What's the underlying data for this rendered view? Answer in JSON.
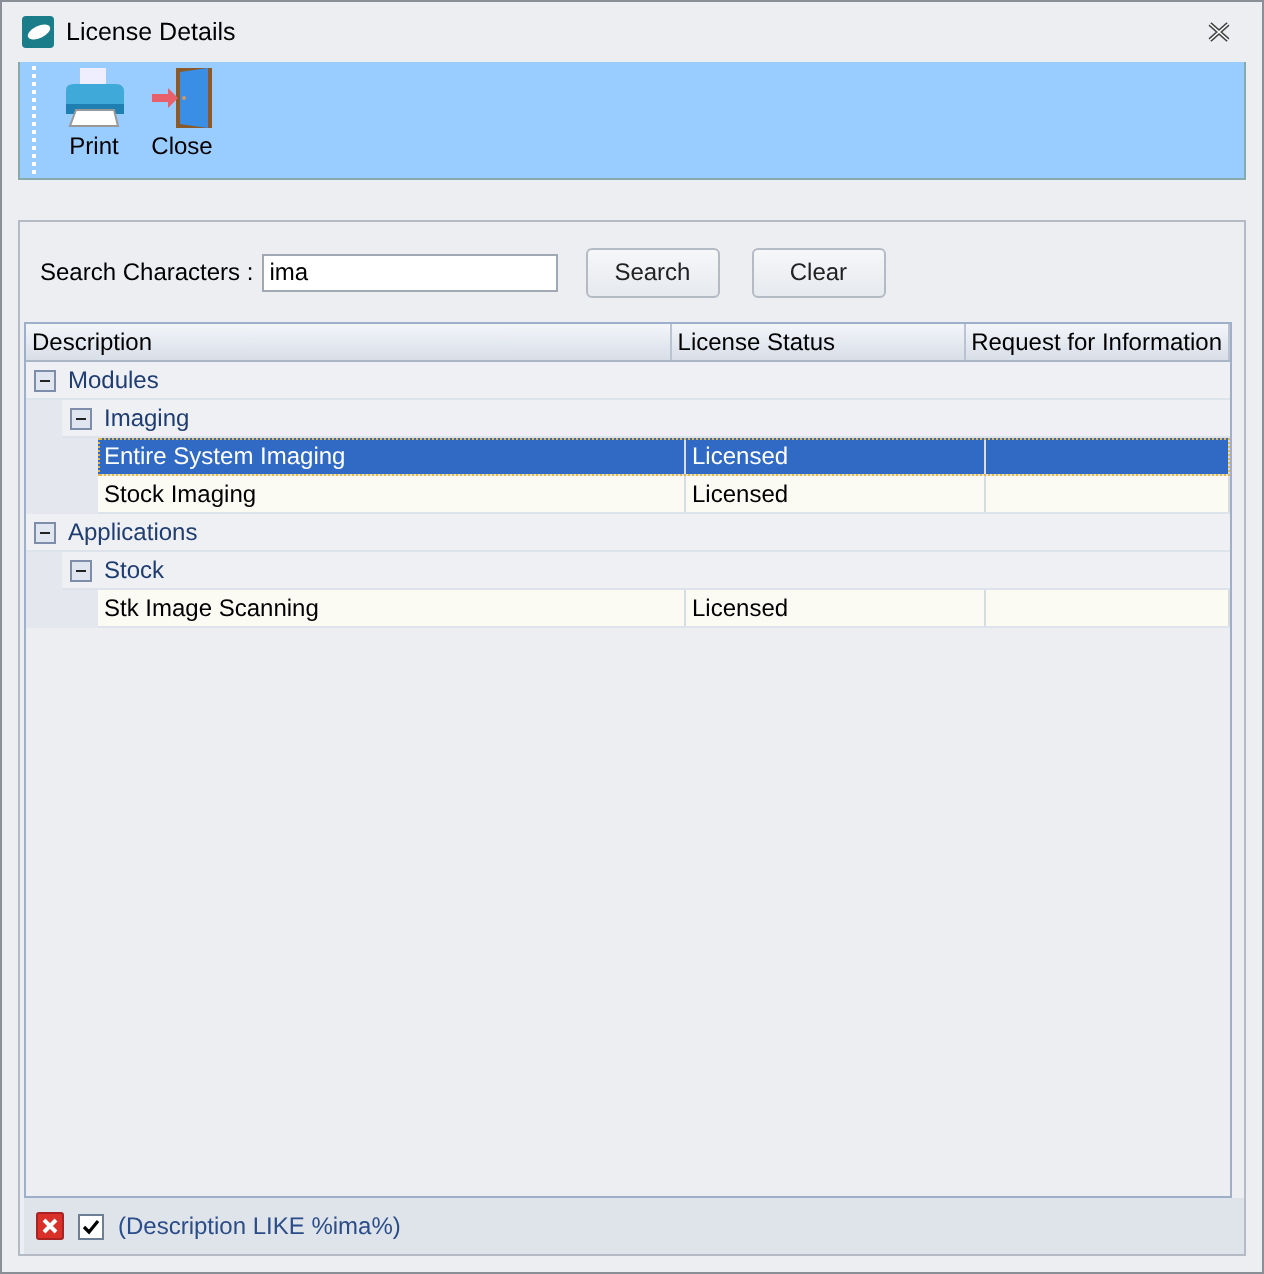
{
  "window": {
    "title": "License Details"
  },
  "toolbar": [
    {
      "label": "Print",
      "kind": "print"
    },
    {
      "label": "Close",
      "kind": "close"
    }
  ],
  "search": {
    "label": "Search Characters :",
    "value": "ima",
    "buttons": [
      "Search",
      "Clear"
    ]
  },
  "grid": {
    "columns": [
      "Description",
      "License Status",
      "Request for Information"
    ],
    "groups": [
      {
        "label": "Modules",
        "expanded": true,
        "children": [
          {
            "label": "Imaging",
            "expanded": true,
            "rows": [
              {
                "description": "Entire System Imaging",
                "status": "Licensed",
                "selected": true
              },
              {
                "description": "Stock Imaging",
                "status": "Licensed",
                "selected": false
              }
            ]
          }
        ]
      },
      {
        "label": "Applications",
        "expanded": true,
        "children": [
          {
            "label": "Stock",
            "expanded": true,
            "rows": [
              {
                "description": "Stk Image Scanning",
                "status": "Licensed",
                "selected": false
              }
            ]
          }
        ]
      }
    ]
  },
  "filter": {
    "enabled": true,
    "text": "(Description LIKE %ima%)"
  }
}
